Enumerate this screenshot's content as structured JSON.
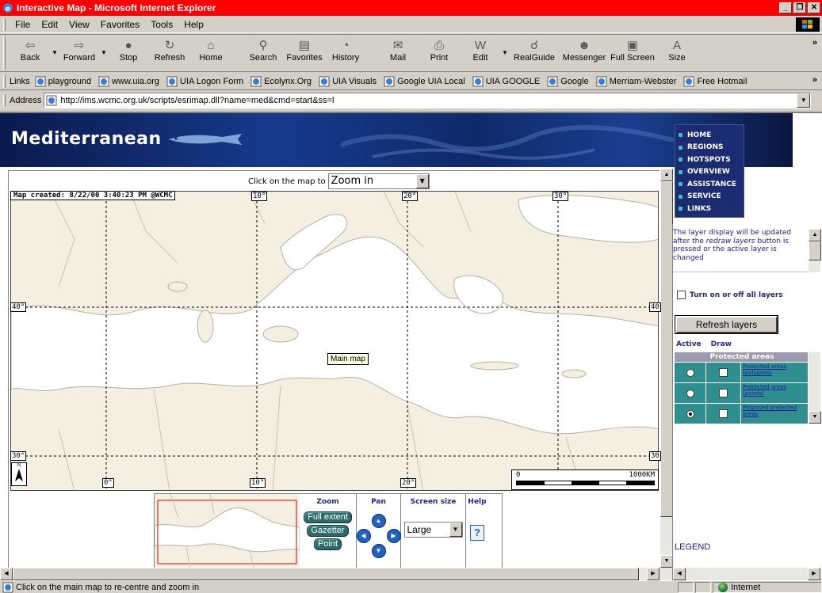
{
  "window": {
    "title": "Interactive Map - Microsoft Internet Explorer"
  },
  "menu": [
    "File",
    "Edit",
    "View",
    "Favorites",
    "Tools",
    "Help"
  ],
  "toolbar": [
    {
      "label": "Back",
      "icon": "back-arrow-icon"
    },
    {
      "label": "Forward",
      "icon": "forward-arrow-icon"
    },
    {
      "label": "Stop",
      "icon": "stop-icon"
    },
    {
      "label": "Refresh",
      "icon": "refresh-icon"
    },
    {
      "label": "Home",
      "icon": "home-icon"
    },
    {
      "label": "Search",
      "icon": "search-icon"
    },
    {
      "label": "Favorites",
      "icon": "favorites-icon"
    },
    {
      "label": "History",
      "icon": "history-icon"
    },
    {
      "label": "Mail",
      "icon": "mail-icon"
    },
    {
      "label": "Print",
      "icon": "print-icon"
    },
    {
      "label": "Edit",
      "icon": "edit-icon"
    },
    {
      "label": "RealGuide",
      "icon": "realguide-icon"
    },
    {
      "label": "Messenger",
      "icon": "messenger-icon"
    },
    {
      "label": "Full Screen",
      "icon": "fullscreen-icon"
    },
    {
      "label": "Size",
      "icon": "size-icon"
    }
  ],
  "links": {
    "label": "Links",
    "items": [
      "playground",
      "www.uia.org",
      "UIA Logon Form",
      "Ecolynx.Org",
      "UIA Visuals",
      "Google UIA Local",
      "UIA GOOGLE",
      "Google",
      "Merriam-Webster",
      "Free Hotmail"
    ]
  },
  "address": {
    "label": "Address",
    "url": "http://ims.wcmc.org.uk/scripts/esrimap.dll?name=med&cmd=start&ss=l"
  },
  "site": {
    "title": "Mediterranean",
    "nav": [
      "HOME",
      "REGIONS",
      "HOTSPOTS",
      "OVERVIEW",
      "ASSISTANCE",
      "SERVICE",
      "LINKS"
    ]
  },
  "map": {
    "click_label": "Click on the map to",
    "click_action": "Zoom in",
    "credit": "Map created: 8/22/00 3:40:23 PM @WCMC",
    "tooltip": "Main map",
    "coord_top": [
      "10°",
      "20°",
      "30°"
    ],
    "coord_bottom": [
      "0°",
      "10°",
      "20°"
    ],
    "coord_left": [
      "40°",
      "30°"
    ],
    "coord_right": [
      "40",
      "30"
    ],
    "north_label": "N",
    "scale_start": "0",
    "scale_end": "1000KM"
  },
  "controls": {
    "zoom_head": "Zoom",
    "pan_head": "Pan",
    "size_head": "Screen size",
    "help_head": "Help",
    "zoom_buttons": [
      "Full extent",
      "Gazetter",
      "Point"
    ],
    "screen_size": "Large",
    "help_symbol": "?"
  },
  "panel": {
    "info_part1": "The layer display will be updated after the ",
    "info_italic": "redraw layers",
    "info_part2": " button is pressed or the active layer is changed",
    "toggle_all": "Turn on or off all layers",
    "refresh_button": "Refresh layers",
    "col_active": "Active",
    "col_draw": "Draw",
    "layer_group": "Protected areas",
    "layers": [
      {
        "name": "Protected areas (polygons)",
        "active": false
      },
      {
        "name": "Protected areas (points)",
        "active": false
      },
      {
        "name": "Proposed protected areas",
        "active": true
      }
    ],
    "legend": "LEGEND"
  },
  "status": {
    "text": "Click on the main map to re-centre and zoom in",
    "zone": "Internet"
  },
  "colors": {
    "titlebar": "#ff0000",
    "banner": "#163b8c",
    "layer_row": "#2f8f8f"
  }
}
